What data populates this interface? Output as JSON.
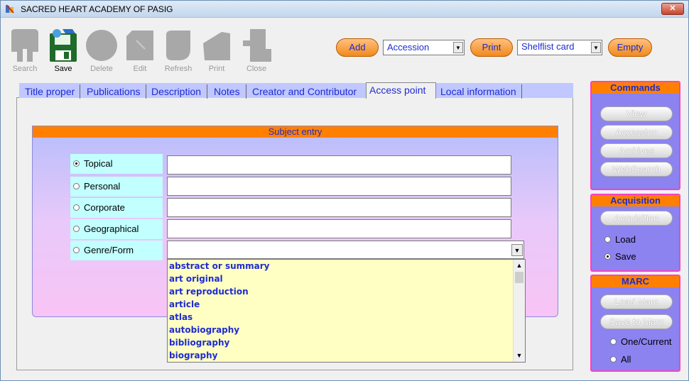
{
  "window": {
    "title": "SACRED HEART ACADEMY OF PASIG",
    "close_label": "✕"
  },
  "toolbar": {
    "search": "Search",
    "save": "Save",
    "delete": "Delete",
    "edit": "Edit",
    "refresh": "Refresh",
    "print": "Print",
    "close": "Close"
  },
  "actions": {
    "add_label": "Add",
    "accession_value": "Accession",
    "print_label": "Print",
    "shelflist_value": "Shelflist card",
    "empty_label": "Empty",
    "arrow": "▼"
  },
  "tabs": [
    "Title proper",
    "Publications",
    "Description",
    "Notes",
    "Creator and Contributor",
    "Access point",
    "Local information"
  ],
  "subject": {
    "header": "Subject entry",
    "options": [
      "Topical",
      "Personal",
      "Corporate",
      "Geographical",
      "Genre/Form"
    ],
    "genre_list": [
      "abstract or summary",
      "art original",
      "art reproduction",
      "article",
      "atlas",
      "autobiography",
      "bibliography",
      "biography"
    ]
  },
  "commands": {
    "header": "Commands",
    "view": "View",
    "accession": "Accession",
    "archives": "Archives",
    "websearch": "WebSearch"
  },
  "acquisition": {
    "header": "Acquisition",
    "button": "Acquisition",
    "load": "Load",
    "save": "Save"
  },
  "marc": {
    "header": "MARC",
    "load": "Load Marc",
    "save": "Save to Marc",
    "one": "One/Current",
    "all": "All"
  },
  "scroll": {
    "up": "▲",
    "down": "▼"
  },
  "colors": {
    "accent": "#ff8000",
    "label": "#1e2bd1",
    "panel": "#8c82f0"
  }
}
